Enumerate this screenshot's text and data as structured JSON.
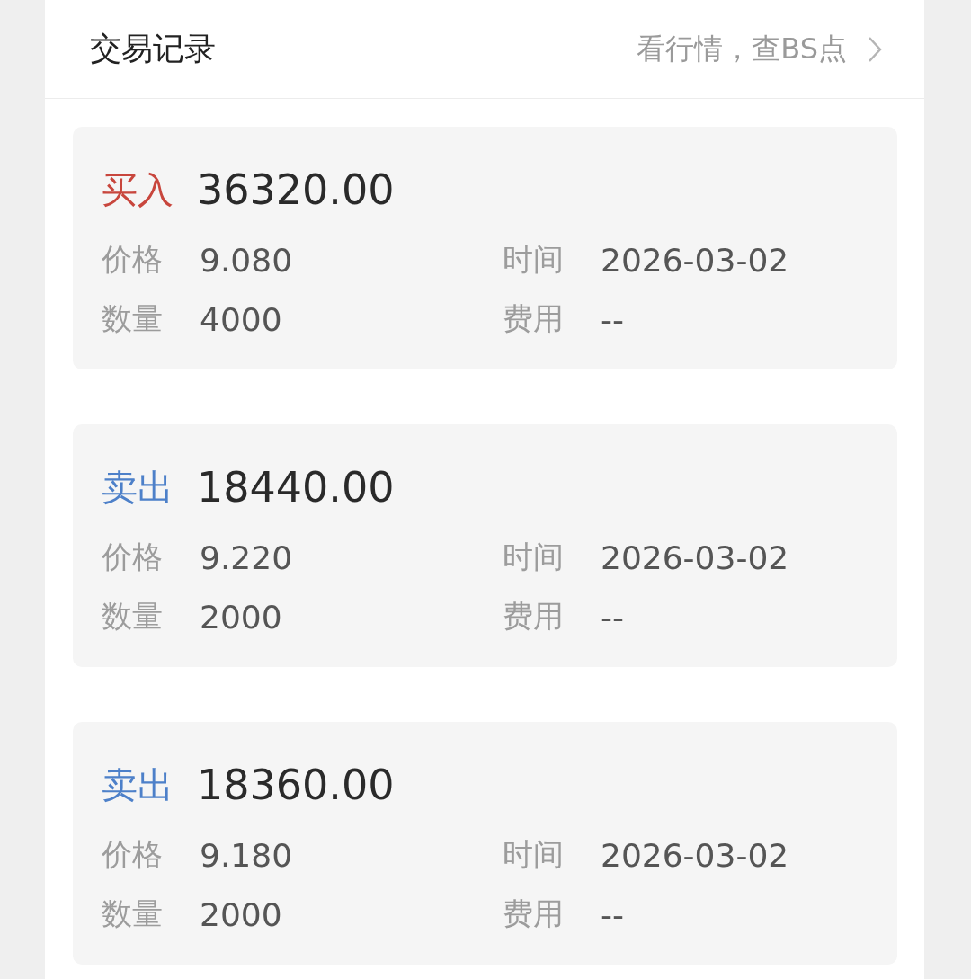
{
  "header": {
    "title": "交易记录",
    "link": "看行情，查BS点"
  },
  "trades": [
    {
      "kind": "buy",
      "type": "买入",
      "amount": "36320.00",
      "fields": [
        {
          "label": "价格",
          "value": "9.080"
        },
        {
          "label": "时间",
          "value": "2026-03-02"
        },
        {
          "label": "数量",
          "value": "4000"
        },
        {
          "label": "费用",
          "value": "--"
        }
      ]
    },
    {
      "kind": "sell",
      "type": "卖出",
      "amount": "18440.00",
      "fields": [
        {
          "label": "价格",
          "value": "9.220"
        },
        {
          "label": "时间",
          "value": "2026-03-02"
        },
        {
          "label": "数量",
          "value": "2000"
        },
        {
          "label": "费用",
          "value": "--"
        }
      ]
    },
    {
      "kind": "sell",
      "type": "卖出",
      "amount": "18360.00",
      "fields": [
        {
          "label": "价格",
          "value": "9.180"
        },
        {
          "label": "时间",
          "value": "2026-03-02"
        },
        {
          "label": "数量",
          "value": "2000"
        },
        {
          "label": "费用",
          "value": "--"
        }
      ]
    }
  ]
}
